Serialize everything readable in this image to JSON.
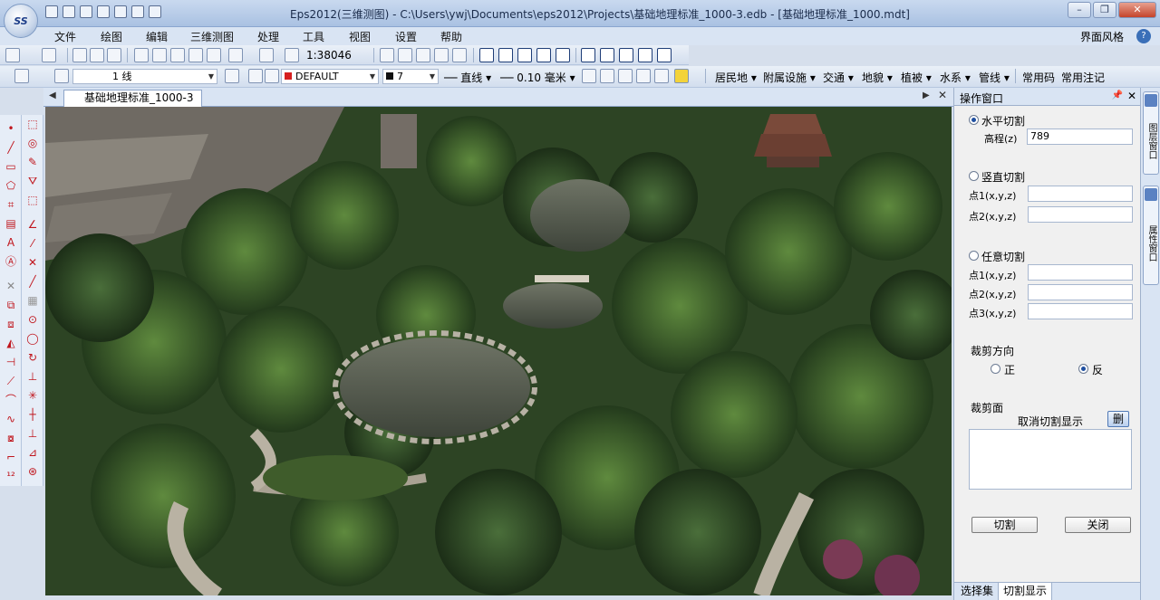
{
  "window": {
    "title": "Eps2012(三维测图) -  C:\\Users\\ywj\\Documents\\eps2012\\Projects\\基础地理标准_1000-3.edb - [基础地理标准_1000.mdt]",
    "logo_text": "SS"
  },
  "menu": {
    "items": [
      "文件",
      "绘图",
      "编辑",
      "三维测图",
      "处理",
      "工具",
      "视图",
      "设置",
      "帮助"
    ],
    "style_label": "界面风格"
  },
  "toolbar1": {
    "scale_value": "1:38046"
  },
  "toolbar2": {
    "line_label": "1 线",
    "layer_value": "DEFAULT",
    "color_value": "7",
    "linetype_value": "直线",
    "linewidth_value": "0.10 毫米",
    "categories": [
      "居民地",
      "附属设施",
      "交通",
      "地貌",
      "植被",
      "水系",
      "管线"
    ],
    "common_code": "常用码",
    "common_note": "常用注记"
  },
  "document": {
    "tab_label": "基础地理标准_1000-3"
  },
  "panel": {
    "title": "操作窗口",
    "horizontal_cut": "水平切割",
    "elevation_label": "高程(z)",
    "elevation_value": "789",
    "vertical_cut": "竖直切割",
    "point1_label": "点1(x,y,z)",
    "point2_label": "点2(x,y,z)",
    "arbitrary_cut": "任意切割",
    "point3_label": "点3(x,y,z)",
    "direction_label": "裁剪方向",
    "direction_positive": "正",
    "direction_negative": "反",
    "cut_face_label": "裁剪面",
    "cancel_display": "取消切割显示",
    "delete_button": "删",
    "cut_button": "切割",
    "close_button": "关闭",
    "tab_selection": "选择集",
    "tab_cut_display": "切割显示"
  },
  "sidestrip": {
    "tab1": "图层窗口",
    "tab2": "属性窗口"
  }
}
